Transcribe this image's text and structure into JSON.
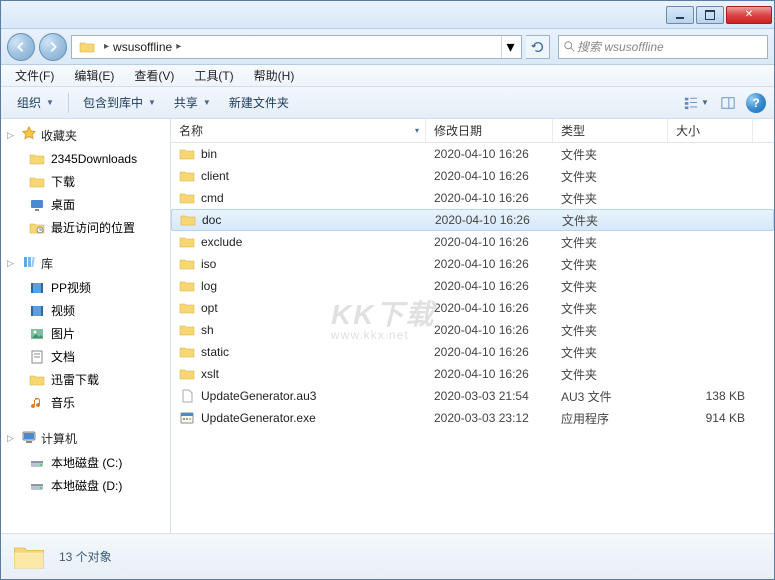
{
  "window": {
    "path_root": "wsusoffline",
    "search_placeholder": "搜索 wsusoffline"
  },
  "menubar": [
    {
      "label": "文件(F)"
    },
    {
      "label": "编辑(E)"
    },
    {
      "label": "查看(V)"
    },
    {
      "label": "工具(T)"
    },
    {
      "label": "帮助(H)"
    }
  ],
  "toolbar": {
    "organize": "组织",
    "include": "包含到库中",
    "share": "共享",
    "newfolder": "新建文件夹"
  },
  "columns": {
    "name": "名称",
    "date": "修改日期",
    "type": "类型",
    "size": "大小"
  },
  "sidebar": {
    "favorites": {
      "label": "收藏夹",
      "items": [
        {
          "label": "2345Downloads",
          "icon": "folder"
        },
        {
          "label": "下载",
          "icon": "folder"
        },
        {
          "label": "桌面",
          "icon": "desktop"
        },
        {
          "label": "最近访问的位置",
          "icon": "recent"
        }
      ]
    },
    "libraries": {
      "label": "库",
      "items": [
        {
          "label": "PP视频",
          "icon": "video"
        },
        {
          "label": "视频",
          "icon": "video"
        },
        {
          "label": "图片",
          "icon": "pictures"
        },
        {
          "label": "文档",
          "icon": "docs"
        },
        {
          "label": "迅雷下载",
          "icon": "folder"
        },
        {
          "label": "音乐",
          "icon": "music"
        }
      ]
    },
    "computer": {
      "label": "计算机",
      "items": [
        {
          "label": "本地磁盘 (C:)",
          "icon": "drive"
        },
        {
          "label": "本地磁盘 (D:)",
          "icon": "drive"
        }
      ]
    }
  },
  "files": [
    {
      "name": "bin",
      "date": "2020-04-10 16:26",
      "type": "文件夹",
      "size": "",
      "icon": "folder"
    },
    {
      "name": "client",
      "date": "2020-04-10 16:26",
      "type": "文件夹",
      "size": "",
      "icon": "folder"
    },
    {
      "name": "cmd",
      "date": "2020-04-10 16:26",
      "type": "文件夹",
      "size": "",
      "icon": "folder"
    },
    {
      "name": "doc",
      "date": "2020-04-10 16:26",
      "type": "文件夹",
      "size": "",
      "icon": "folder",
      "selected": true
    },
    {
      "name": "exclude",
      "date": "2020-04-10 16:26",
      "type": "文件夹",
      "size": "",
      "icon": "folder"
    },
    {
      "name": "iso",
      "date": "2020-04-10 16:26",
      "type": "文件夹",
      "size": "",
      "icon": "folder"
    },
    {
      "name": "log",
      "date": "2020-04-10 16:26",
      "type": "文件夹",
      "size": "",
      "icon": "folder"
    },
    {
      "name": "opt",
      "date": "2020-04-10 16:26",
      "type": "文件夹",
      "size": "",
      "icon": "folder"
    },
    {
      "name": "sh",
      "date": "2020-04-10 16:26",
      "type": "文件夹",
      "size": "",
      "icon": "folder"
    },
    {
      "name": "static",
      "date": "2020-04-10 16:26",
      "type": "文件夹",
      "size": "",
      "icon": "folder"
    },
    {
      "name": "xslt",
      "date": "2020-04-10 16:26",
      "type": "文件夹",
      "size": "",
      "icon": "folder"
    },
    {
      "name": "UpdateGenerator.au3",
      "date": "2020-03-03 21:54",
      "type": "AU3 文件",
      "size": "138 KB",
      "icon": "file"
    },
    {
      "name": "UpdateGenerator.exe",
      "date": "2020-03-03 23:12",
      "type": "应用程序",
      "size": "914 KB",
      "icon": "exe"
    }
  ],
  "status": {
    "count": "13 个对象"
  },
  "watermark": {
    "big": "KK下载",
    "small": "www.kkx.net"
  }
}
